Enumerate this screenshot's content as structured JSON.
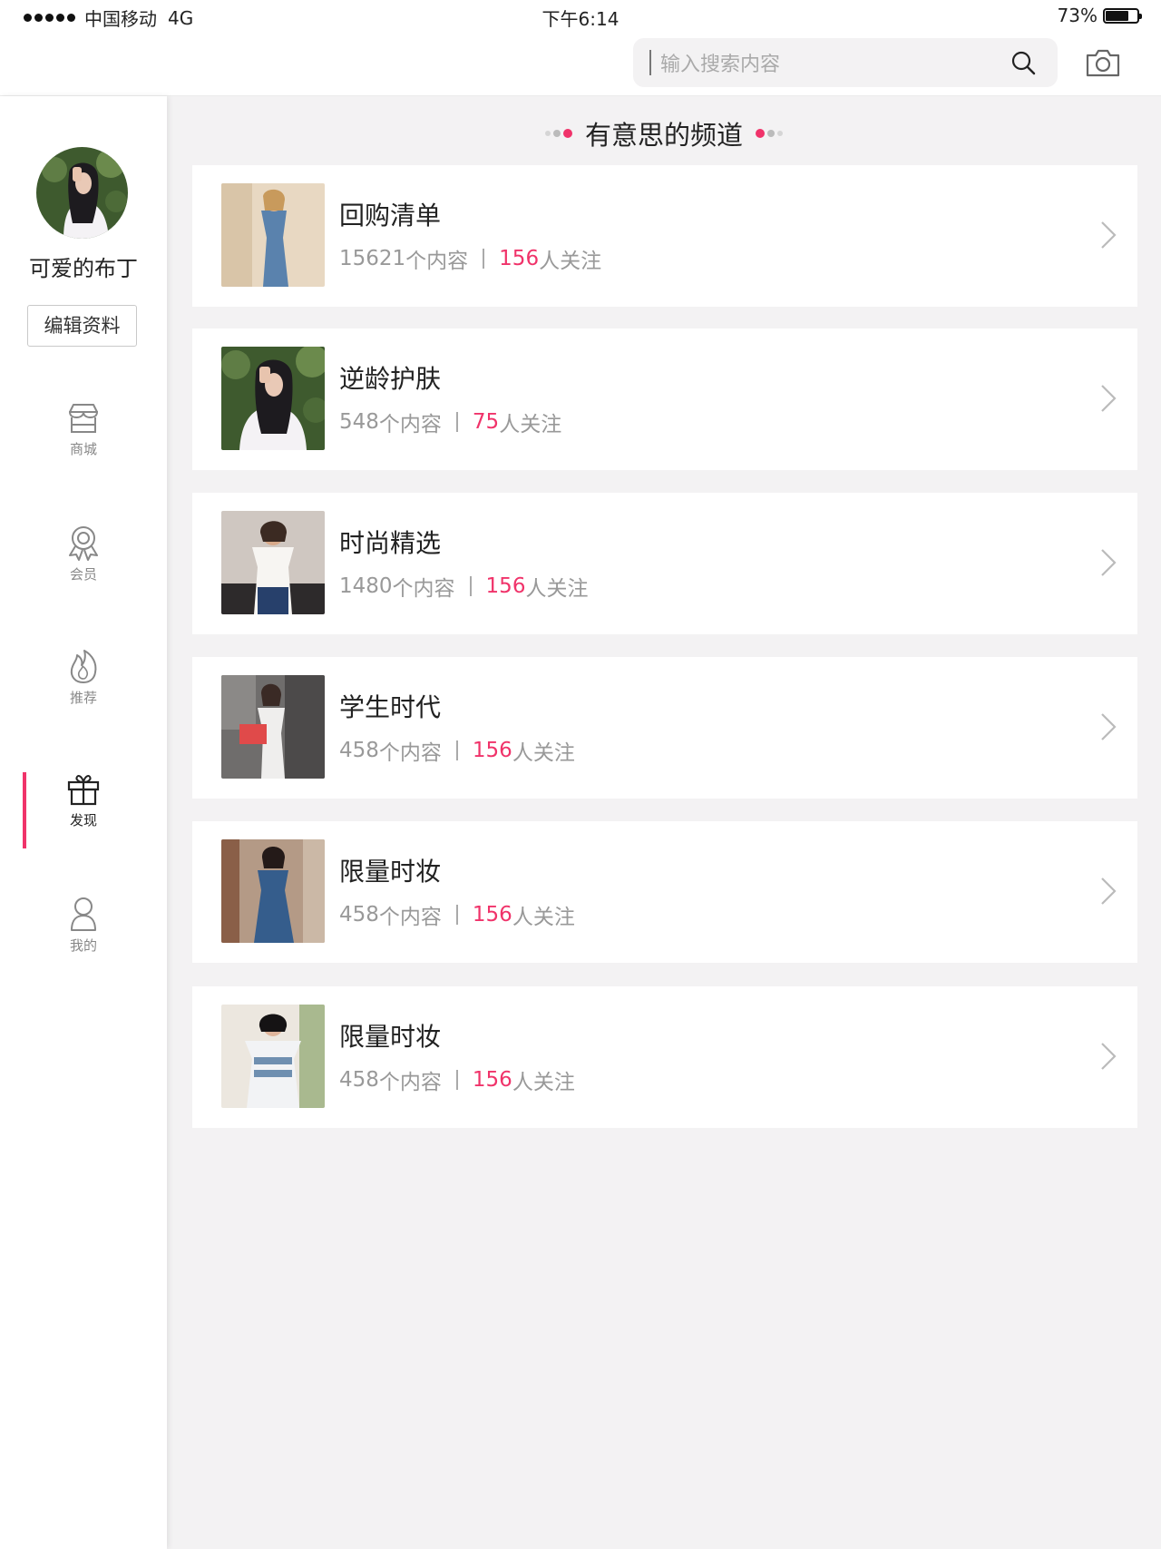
{
  "status_bar": {
    "carrier": "中国移动",
    "network": "4G",
    "time": "下午6:14",
    "battery_percent": "73%",
    "battery_level": 0.73
  },
  "search": {
    "placeholder": "输入搜索内容"
  },
  "profile": {
    "username": "可爱的布丁",
    "edit_label": "编辑资料"
  },
  "nav": [
    {
      "label": "商城",
      "icon": "shop-icon",
      "active": false
    },
    {
      "label": "会员",
      "icon": "member-badge-icon",
      "active": false
    },
    {
      "label": "推荐",
      "icon": "flame-icon",
      "active": false
    },
    {
      "label": "发现",
      "icon": "gift-icon",
      "active": true
    },
    {
      "label": "我的",
      "icon": "user-icon",
      "active": false
    }
  ],
  "section_title": "有意思的频道",
  "channels": [
    {
      "title": "回购清单",
      "content_count": "15621",
      "content_suffix": "个内容",
      "follow_count": "156",
      "follow_suffix": "人关注"
    },
    {
      "title": "逆龄护肤",
      "content_count": "548",
      "content_suffix": "个内容",
      "follow_count": "75",
      "follow_suffix": "人关注"
    },
    {
      "title": "时尚精选",
      "content_count": "1480",
      "content_suffix": "个内容",
      "follow_count": "156",
      "follow_suffix": "人关注"
    },
    {
      "title": "学生时代",
      "content_count": "458",
      "content_suffix": "个内容",
      "follow_count": "156",
      "follow_suffix": "人关注"
    },
    {
      "title": "限量时妆",
      "content_count": "458",
      "content_suffix": "个内容",
      "follow_count": "156",
      "follow_suffix": "人关注"
    },
    {
      "title": "限量时妆",
      "content_count": "458",
      "content_suffix": "个内容",
      "follow_count": "156",
      "follow_suffix": "人关注"
    }
  ],
  "colors": {
    "accent": "#f0336a",
    "background": "#f3f2f3",
    "muted_text": "#999999"
  }
}
